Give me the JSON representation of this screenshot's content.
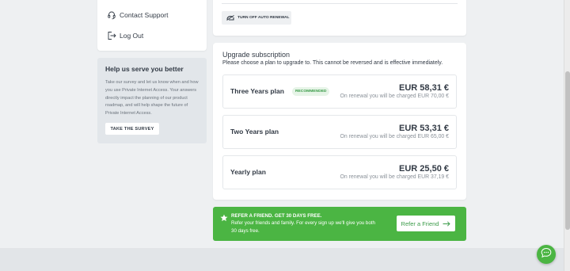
{
  "menu": {
    "items": [
      {
        "label": "Contact Support",
        "icon": "headset-icon"
      },
      {
        "label": "Log Out",
        "icon": "logout-icon"
      }
    ]
  },
  "survey": {
    "title": "Help us serve you better",
    "body": "Take our survey and let us know when and how you use Private Internet Access. Your answers directly impact the planning of our product roadmap, and will help shape the future of Private Internet Access.",
    "button_label": "TAKE THE SURVEY"
  },
  "auto_renewal": {
    "button_label": "TURN OFF AUTO RENEWAL"
  },
  "upgrade": {
    "title": "Upgrade subscription",
    "subtitle": "Please choose a plan to upgrade to. This cannot be reversed and is effective immediately.",
    "plans": [
      {
        "name": "Three Years plan",
        "badge": "RECOMMENDED",
        "price": "EUR 58,31 €",
        "renewal": "On renewal you will be charged EUR 70,00 €"
      },
      {
        "name": "Two Years plan",
        "badge": "",
        "price": "EUR 53,31 €",
        "renewal": "On renewal you will be charged EUR 65,00 €"
      },
      {
        "name": "Yearly plan",
        "badge": "",
        "price": "EUR 25,50 €",
        "renewal": "On renewal you will be charged EUR 37,19 €"
      }
    ]
  },
  "refer": {
    "title": "REFER A FRIEND. GET 30 DAYS FREE.",
    "text": "Refer your friends and family. For every sign up we'll give you both 30 days free.",
    "button_label": "Refer a Friend"
  },
  "colors": {
    "accent_green": "#4bb543",
    "text_dark": "#323a45",
    "page_bg": "#eef0f2"
  }
}
